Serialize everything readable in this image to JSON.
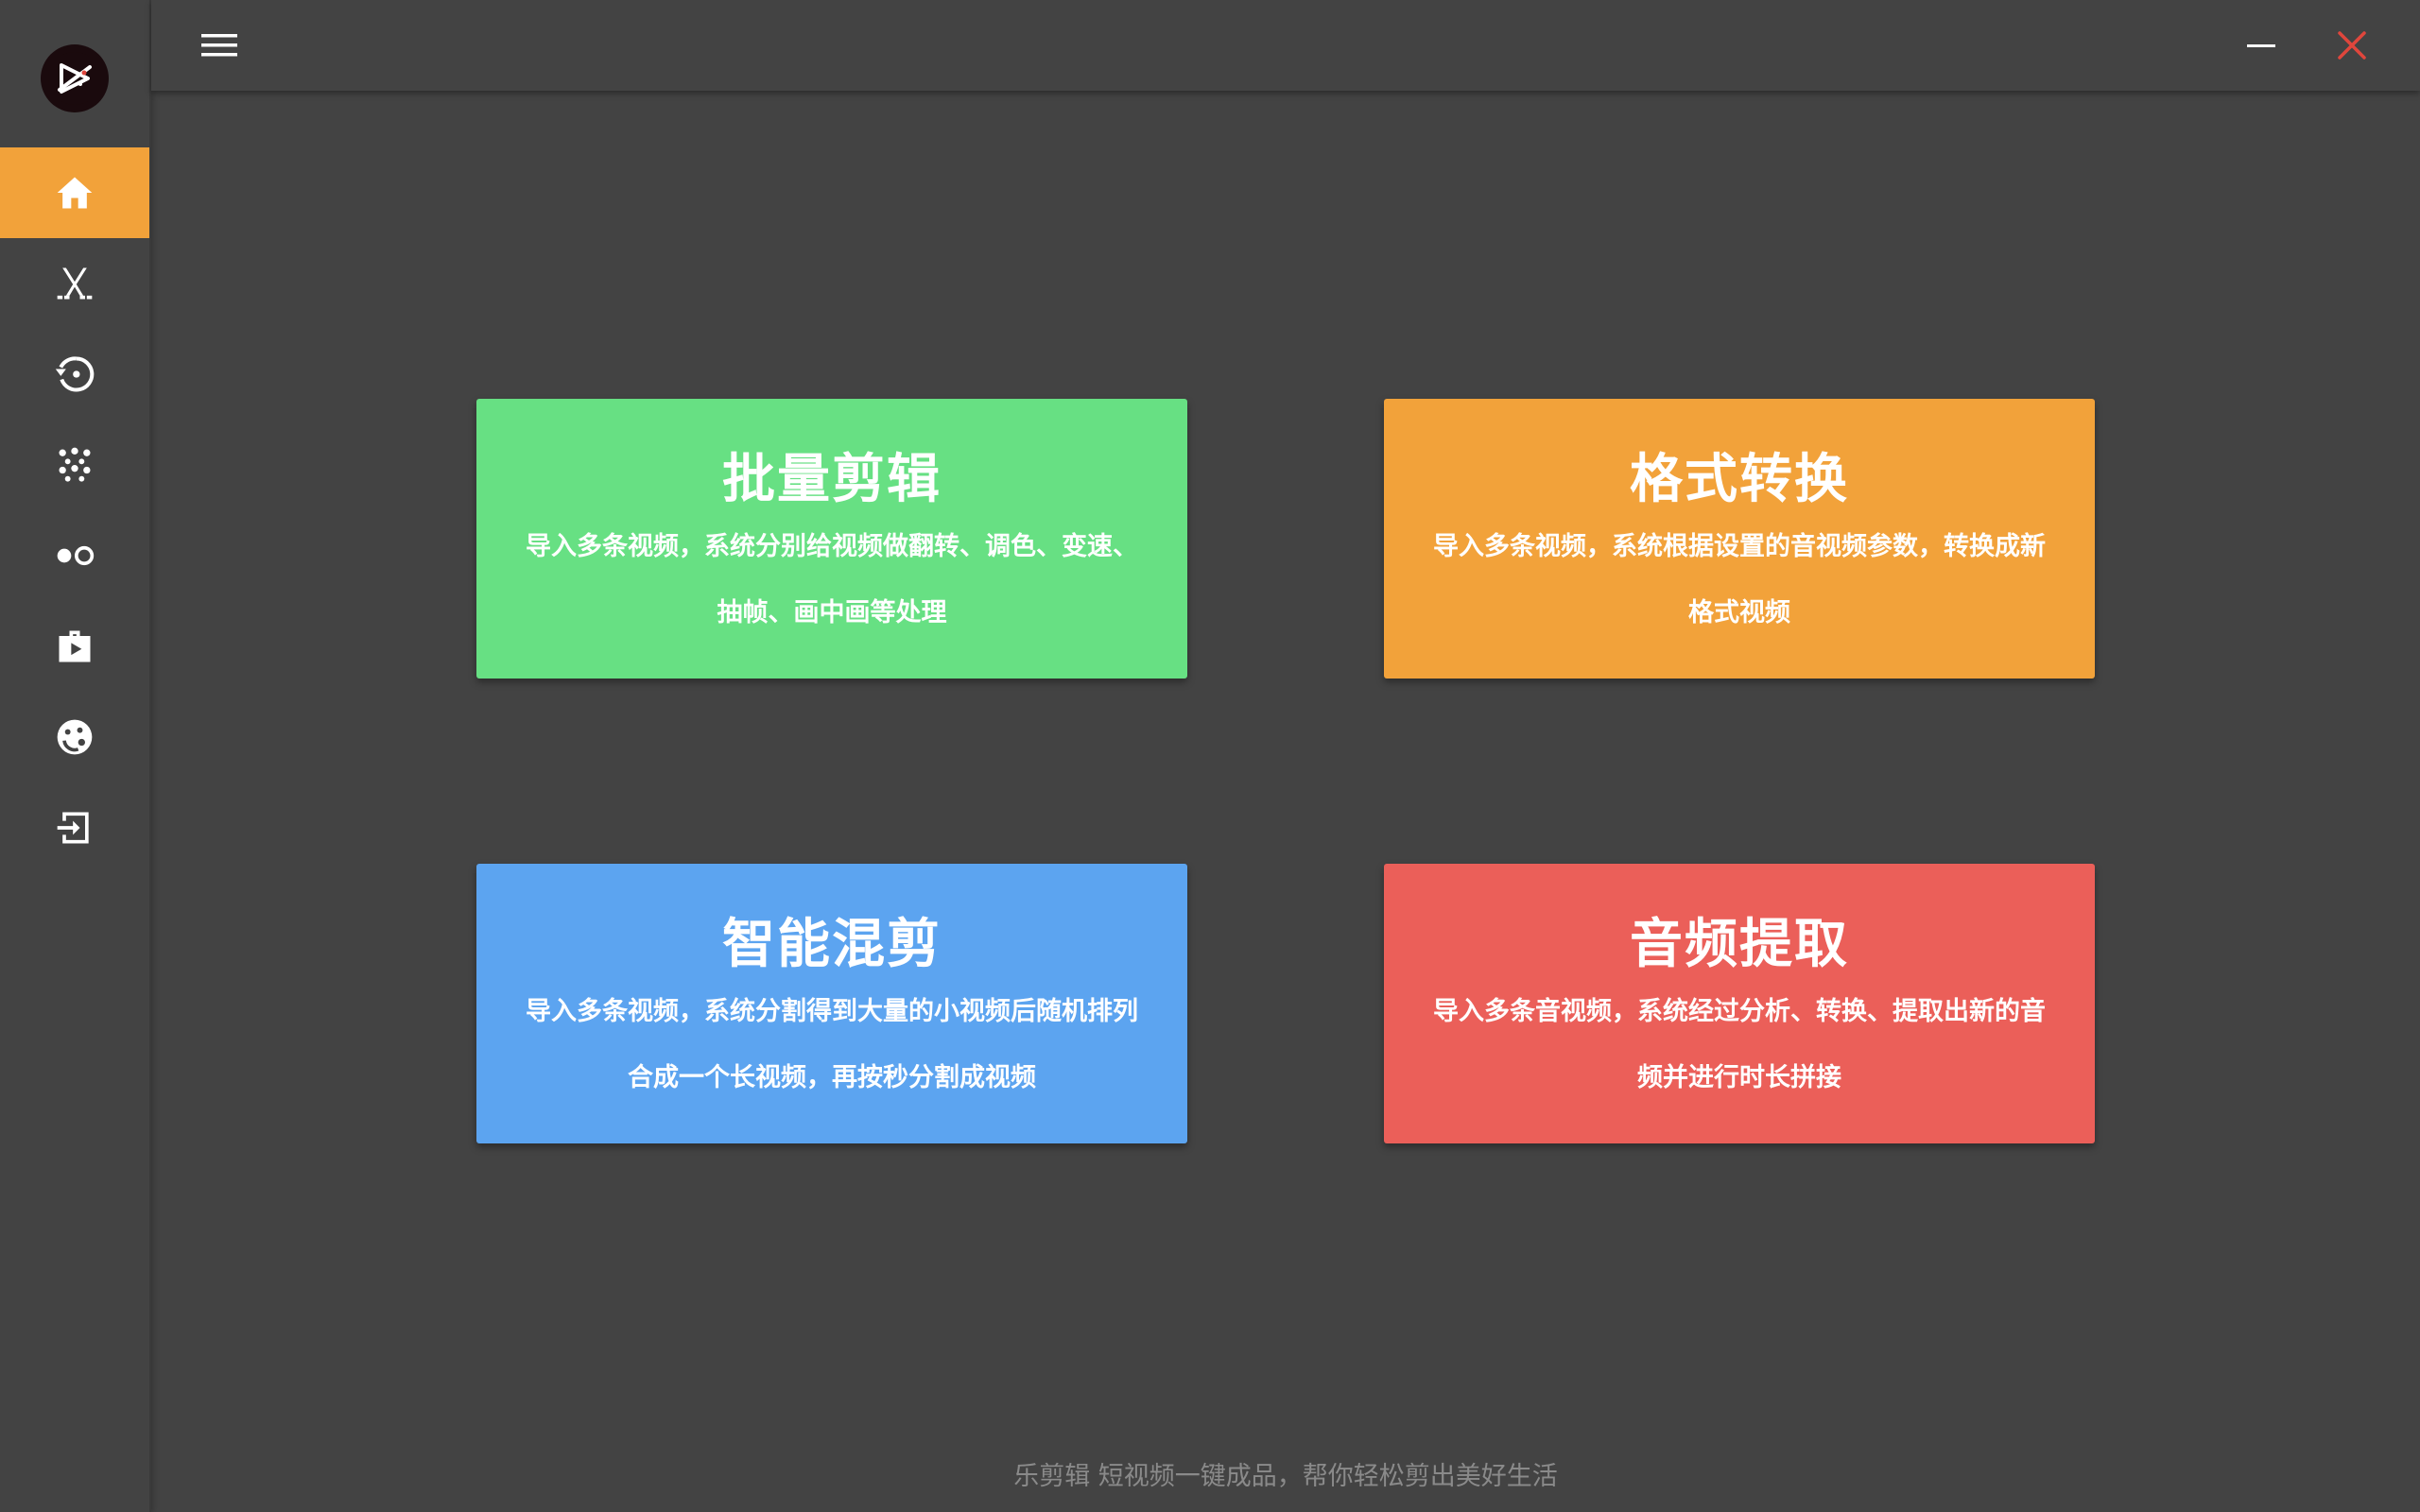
{
  "window": {
    "menu_icon": "hamburger-menu-icon",
    "minimize_icon": "minimize-icon",
    "close_icon": "close-icon",
    "close_color": "#e0463c"
  },
  "sidebar": {
    "logo_icon": "app-logo-icon",
    "active_color": "#f2a23a",
    "items": [
      {
        "icon": "home-icon",
        "active": true
      },
      {
        "icon": "cut-icon",
        "active": false
      },
      {
        "icon": "history-icon",
        "active": false
      },
      {
        "icon": "dots-icon",
        "active": false
      },
      {
        "icon": "toggle-icon",
        "active": false
      },
      {
        "icon": "video-bag-icon",
        "active": false
      },
      {
        "icon": "face-icon",
        "active": false
      },
      {
        "icon": "exit-icon",
        "active": false
      }
    ]
  },
  "cards": [
    {
      "title": "批量剪辑",
      "desc_line1": "导入多条视频，系统分别给视频做翻转、调色、变速、",
      "desc_line2": "抽帧、画中画等处理",
      "color": "#67e083"
    },
    {
      "title": "格式转换",
      "desc_line1": "导入多条视频，系统根据设置的音视频参数，转换成新",
      "desc_line2": "格式视频",
      "color": "#f2a23a"
    },
    {
      "title": "智能混剪",
      "desc_line1": "导入多条视频，系统分割得到大量的小视频后随机排列",
      "desc_line2": "合成一个长视频，再按秒分割成视频",
      "color": "#5ca4f0"
    },
    {
      "title": "音频提取",
      "desc_line1": "导入多条音视频，系统经过分析、转换、提取出新的音",
      "desc_line2": "频并进行时长拼接",
      "color": "#eb5f59"
    }
  ],
  "footer": {
    "text": "乐剪辑 短视频一键成品，帮你轻松剪出美好生活"
  }
}
